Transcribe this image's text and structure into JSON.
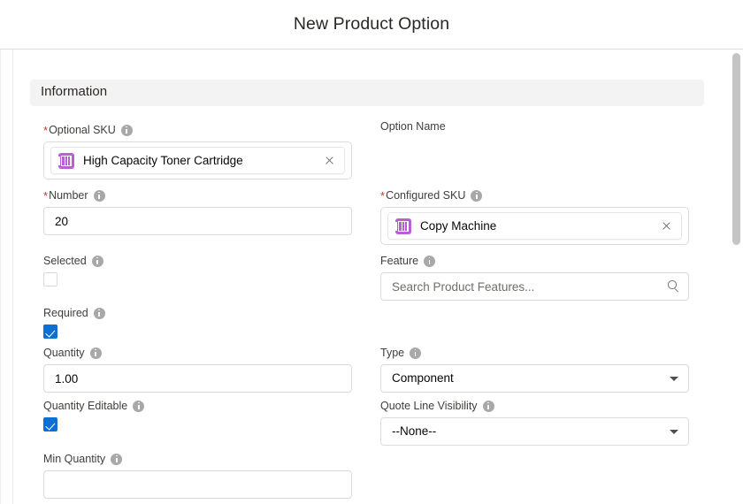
{
  "header": {
    "title": "New Product Option"
  },
  "section": {
    "title": "Information"
  },
  "fields": {
    "optional_sku": {
      "label": "Optional SKU",
      "required": true,
      "value": "High Capacity Toner Cartridge",
      "icon": "product-icon",
      "clear_icon": "close-icon",
      "info_icon": "info-icon"
    },
    "option_name": {
      "label": "Option Name",
      "required": false,
      "value": ""
    },
    "number": {
      "label": "Number",
      "required": true,
      "value": "20"
    },
    "configured_sku": {
      "label": "Configured SKU",
      "required": true,
      "value": "Copy Machine",
      "icon": "product-icon",
      "clear_icon": "close-icon"
    },
    "selected": {
      "label": "Selected",
      "checked": false
    },
    "feature": {
      "label": "Feature",
      "value": "",
      "placeholder": "Search Product Features...",
      "icon": "search-icon"
    },
    "required": {
      "label": "Required",
      "checked": true
    },
    "quantity": {
      "label": "Quantity",
      "value": "1.00"
    },
    "type": {
      "label": "Type",
      "value": "Component",
      "options": [
        "Component"
      ],
      "icon": "chevron-down-icon"
    },
    "quantity_editable": {
      "label": "Quantity Editable",
      "checked": true
    },
    "quote_line_visibility": {
      "label": "Quote Line Visibility",
      "value": "--None--",
      "options": [
        "--None--"
      ],
      "icon": "chevron-down-icon"
    },
    "min_quantity": {
      "label": "Min Quantity",
      "value": ""
    }
  },
  "colors": {
    "accent_blue": "#0d6fd1",
    "required_red": "#c23934",
    "product_purple": "#b660d3",
    "section_bg": "#f3f3f3",
    "border": "#dddbda"
  }
}
